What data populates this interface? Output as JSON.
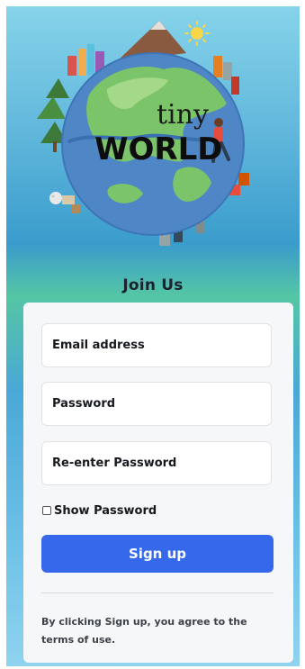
{
  "logo": {
    "line1": "tiny",
    "line2": "WORLD"
  },
  "form": {
    "title": "Join Us",
    "email_placeholder": "Email address",
    "password_placeholder": "Password",
    "reenter_placeholder": "Re-enter Password",
    "show_password_label": "Show Password",
    "show_password_checked": false,
    "signup_label": "Sign up",
    "terms_text": "By clicking Sign up, you agree to the terms of use."
  },
  "colors": {
    "primary_button": "#3568ea",
    "card_background": "#f6f7f8"
  }
}
